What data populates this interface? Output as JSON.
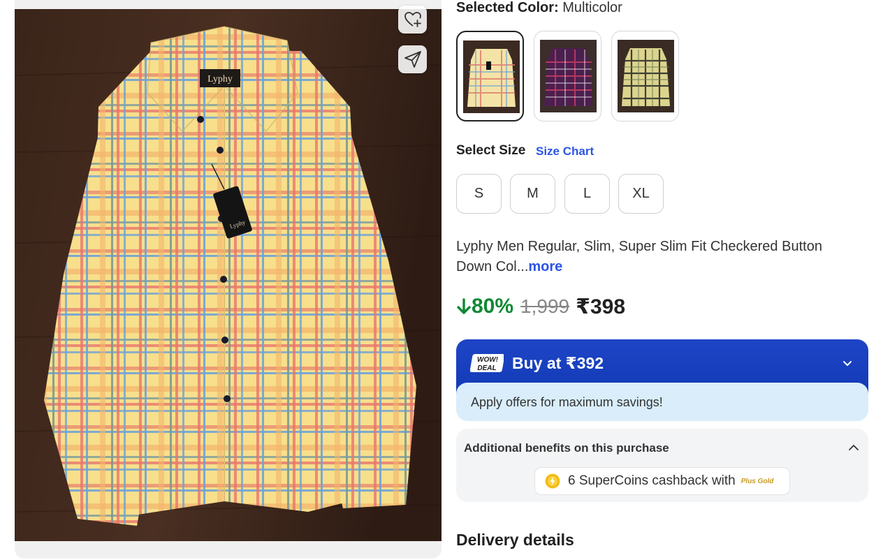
{
  "product_image": {
    "brand_tag": "Lyphy",
    "wishlist_icon": "heart-plus-icon",
    "share_icon": "send-icon"
  },
  "color_selector": {
    "label": "Selected Color:",
    "value": "Multicolor",
    "swatches": [
      {
        "name": "Multicolor",
        "selected": true,
        "base": "#f4d97a",
        "check_a": "#e07a6a",
        "check_b": "#6aa1d8"
      },
      {
        "name": "Purple",
        "selected": false,
        "base": "#4b1f4e",
        "check_a": "#c23b62",
        "check_b": "#ffffff"
      },
      {
        "name": "Yellow",
        "selected": false,
        "base": "#d9d28a",
        "check_a": "#2d2f2b",
        "check_b": "#6e7d55"
      }
    ]
  },
  "size_selector": {
    "title": "Select Size",
    "chart_link": "Size Chart",
    "sizes": [
      "S",
      "M",
      "L",
      "XL"
    ]
  },
  "description": {
    "text": "Lyphy Men Regular, Slim, Super Slim Fit Checkered Button Down Col...",
    "more_link": "more"
  },
  "pricing": {
    "discount": "80%",
    "mrp": "1,999",
    "price": "₹398",
    "discount_color": "#108934"
  },
  "deal": {
    "badge_line1": "WOW!",
    "badge_line2": "DEAL",
    "text": "Buy at ₹392",
    "subtext": "Apply offers for maximum savings!",
    "accent": "#1e45c6"
  },
  "benefits": {
    "title": "Additional benefits on this purchase",
    "supercoins_text": "6 SuperCoins cashback with",
    "plus_label": "Plus Gold"
  },
  "delivery": {
    "title": "Delivery details"
  }
}
